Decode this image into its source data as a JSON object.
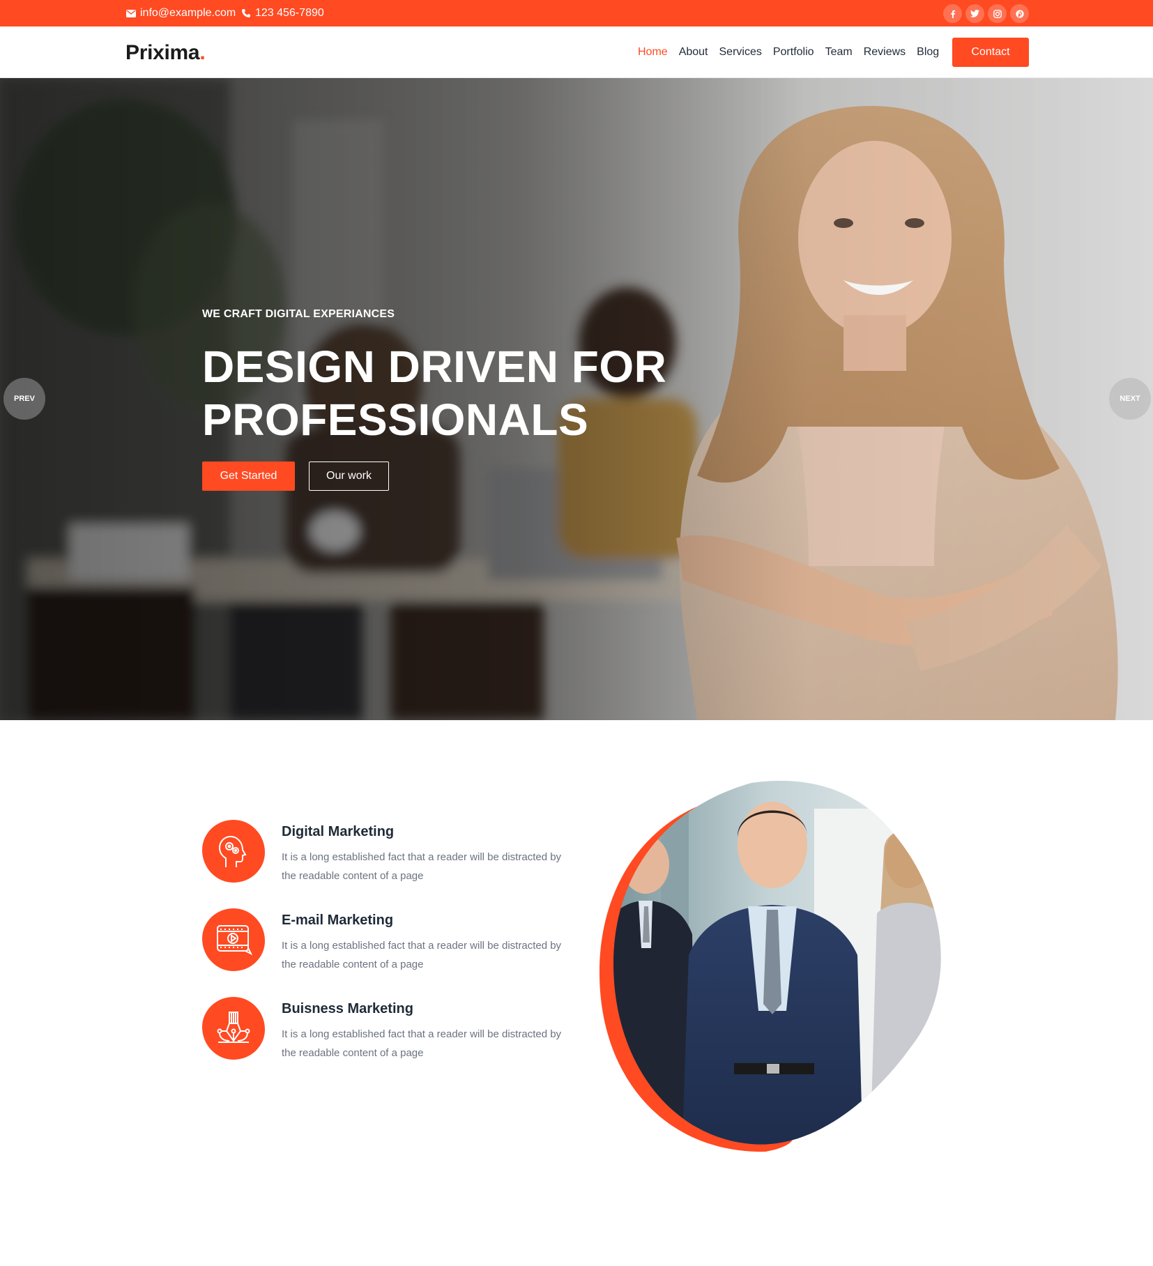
{
  "topbar": {
    "email": "info@example.com",
    "phone": "123 456-7890",
    "socials": [
      "facebook-icon",
      "twitter-icon",
      "instagram-icon",
      "pinterest-icon"
    ]
  },
  "header": {
    "logo_text": "Prixima",
    "logo_dot": ".",
    "nav": [
      {
        "label": "Home",
        "active": true
      },
      {
        "label": "About"
      },
      {
        "label": "Services"
      },
      {
        "label": "Portfolio"
      },
      {
        "label": "Team"
      },
      {
        "label": "Reviews"
      },
      {
        "label": "Blog"
      }
    ],
    "contact_label": "Contact"
  },
  "hero": {
    "kicker": "WE CRAFT DIGITAL EXPERIANCES",
    "title_line1": "DESIGN DRIVEN FOR",
    "title_line2": "PROFESSIONALS",
    "primary_button": "Get Started",
    "secondary_button": "Our work",
    "prev_label": "PREV",
    "next_label": "NEXT"
  },
  "services": [
    {
      "title": "Digital Marketing",
      "desc": "It is a long established fact that a reader will be distracted by the readable content of a page",
      "icon": "brain-head-icon"
    },
    {
      "title": "E-mail Marketing",
      "desc": "It is a long established fact that a reader will be distracted by the readable content of a page",
      "icon": "video-film-icon"
    },
    {
      "title": "Buisness Marketing",
      "desc": "It is a long established fact that a reader will be distracted by the readable content of a page",
      "icon": "pen-tool-icon"
    }
  ],
  "colors": {
    "accent": "#ff4a22",
    "text_dark": "#1f2a37",
    "text_muted": "#6b7280"
  }
}
